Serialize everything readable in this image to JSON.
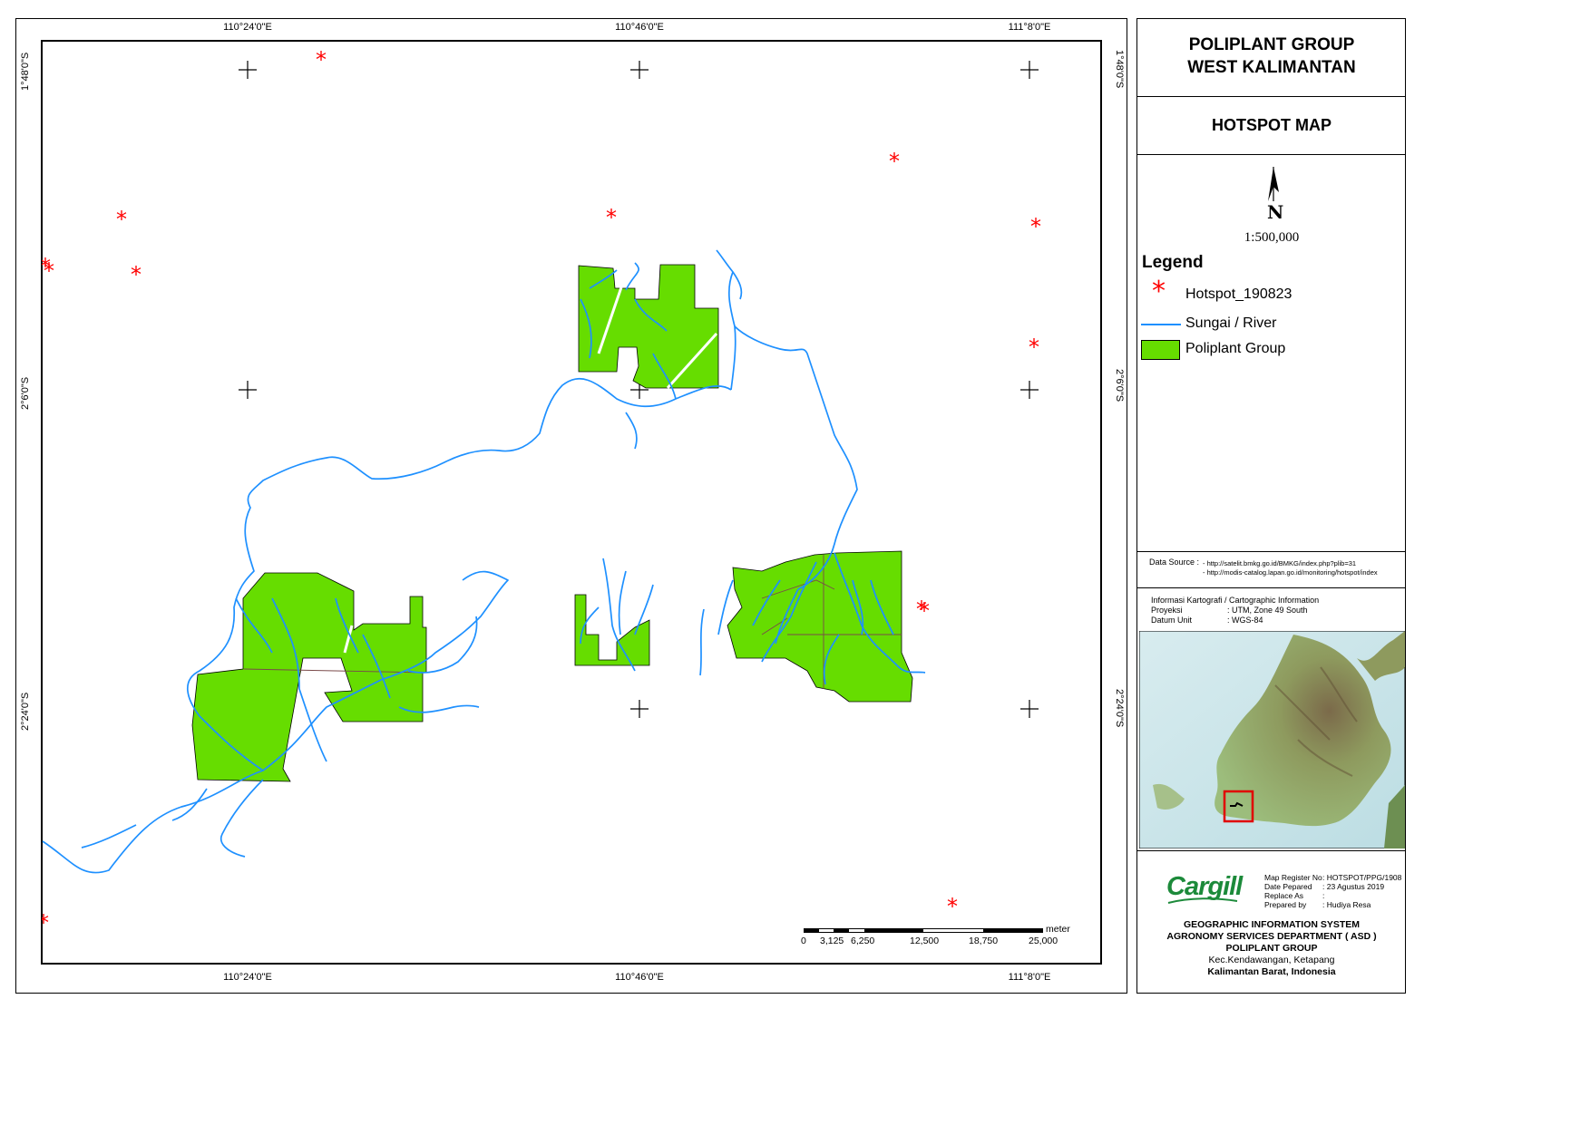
{
  "title_block": {
    "title_line1": "POLIPLANT GROUP",
    "title_line2": "WEST KALIMANTAN",
    "map_name": "HOTSPOT MAP",
    "north_letter": "N",
    "scale_ratio": "1:500,000",
    "legend": {
      "title": "Legend",
      "items": [
        {
          "label": "Hotspot_190823",
          "symbol": "hotspot-asterisk-icon",
          "color": "#ff0000"
        },
        {
          "label": "Sungai / River",
          "symbol": "river-line-icon",
          "color": "#1e90ff"
        },
        {
          "label": "Poliplant Group",
          "symbol": "plantation-polygon-icon",
          "color": "#66dd00"
        }
      ]
    },
    "data_source": {
      "label": "Data Source :",
      "lines": [
        "- http://satelit.bmkg.go.id/BMKG/index.php?plib=31",
        "- http://modis-catalog.lapan.go.id/monitoring/hotspot/index"
      ]
    },
    "carto_info": {
      "heading": "Informasi Kartografi / Cartographic Information",
      "rows": [
        {
          "key": "Proyeksi",
          "value": ": UTM, Zone 49 South"
        },
        {
          "key": "Datum Unit",
          "value": ": WGS-84"
        }
      ]
    },
    "company_logo": "Cargill",
    "register": [
      {
        "key": "Map Register No",
        "value": ": HOTSPOT/PPG/1908"
      },
      {
        "key": "Date Pepared",
        "value": ": 23 Agustus 2019"
      },
      {
        "key": "Replace As",
        "value": ":"
      },
      {
        "key": "Prepared by",
        "value": ": Hudiya Resa"
      }
    ],
    "gis": [
      "GEOGRAPHIC INFORMATION SYSTEM",
      "AGRONOMY SERVICES DEPARTMENT ( ASD )",
      "POLIPLANT GROUP",
      "Kec.Kendawangan, Ketapang",
      "Kalimantan Barat, Indonesia"
    ]
  },
  "map": {
    "lon_labels": [
      "110°24'0\"E",
      "110°46'0\"E",
      "111°8'0\"E"
    ],
    "lat_labels": [
      "1°48'0\"S",
      "2°6'0\"S",
      "2°24'0\"S"
    ],
    "scale_bar": {
      "unit": "meter",
      "ticks": [
        "0",
        "3,125",
        "6,250",
        "12,500",
        "18,750",
        "25,000"
      ]
    },
    "colors": {
      "hotspot": "#ff0000",
      "river": "#1e90ff",
      "plantation": "#66dd00",
      "plantation_outline": "#7a4a4a"
    }
  }
}
